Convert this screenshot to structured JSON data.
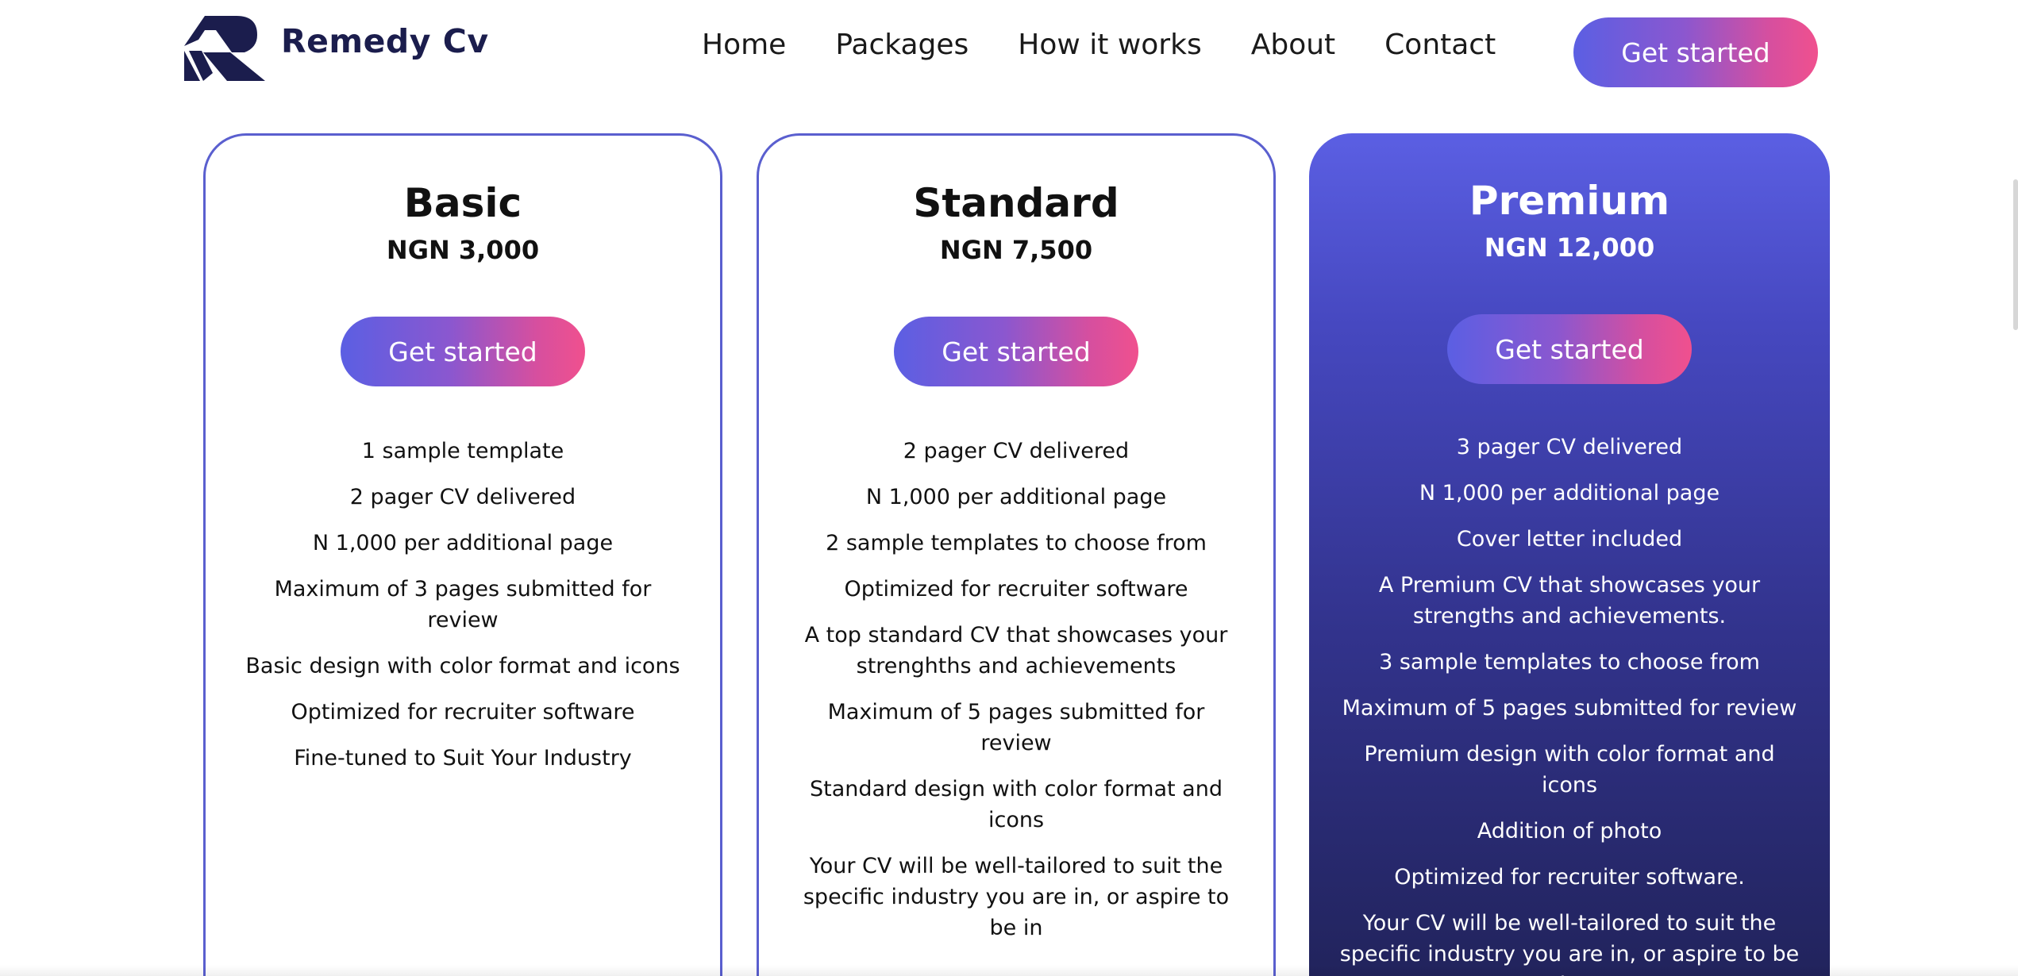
{
  "header": {
    "brand_name": "Remedy Cv",
    "logo_icon": "remedy-r-logo",
    "nav": [
      {
        "label": "Home"
      },
      {
        "label": "Packages"
      },
      {
        "label": "How it works"
      },
      {
        "label": "About"
      },
      {
        "label": "Contact"
      }
    ],
    "cta_label": "Get started"
  },
  "colors": {
    "brand_navy": "#1b1d4d",
    "gradient_start": "#5b5fe3",
    "gradient_end": "#f0508e",
    "card_border": "#5a5fcf",
    "premium_top": "#5b5fe3",
    "premium_bottom": "#202258"
  },
  "plans": [
    {
      "name": "Basic",
      "price": "NGN 3,000",
      "cta_label": "Get started",
      "features": [
        "1 sample template",
        "2 pager CV delivered",
        "N 1,000 per additional page",
        "Maximum of 3 pages submitted for review",
        "Basic design with color format and icons",
        "Optimized for recruiter software",
        "Fine-tuned to Suit Your Industry"
      ]
    },
    {
      "name": "Standard",
      "price": "NGN 7,500",
      "cta_label": "Get started",
      "features": [
        "2 pager CV delivered",
        "N 1,000 per additional page",
        "2 sample templates to choose from",
        "Optimized for recruiter software",
        "A top standard CV that showcases your strenghths and achievements",
        "Maximum of 5 pages submitted for review",
        "Standard design with color format and icons",
        "Your CV will be well-tailored to suit the specific industry you are in, or aspire to be in"
      ]
    },
    {
      "name": "Premium",
      "price": "NGN 12,000",
      "cta_label": "Get started",
      "features": [
        "3 pager CV delivered",
        "N 1,000 per additional page",
        "Cover letter included",
        "A Premium CV that showcases your strengths and achievements.",
        "3 sample templates to choose from",
        "Maximum of 5 pages submitted for review",
        "Premium design with color format and icons",
        "Addition of photo",
        "Optimized for recruiter software.",
        "Your CV will be well-tailored to suit the specific industry you are in, or aspire to be in"
      ]
    }
  ]
}
